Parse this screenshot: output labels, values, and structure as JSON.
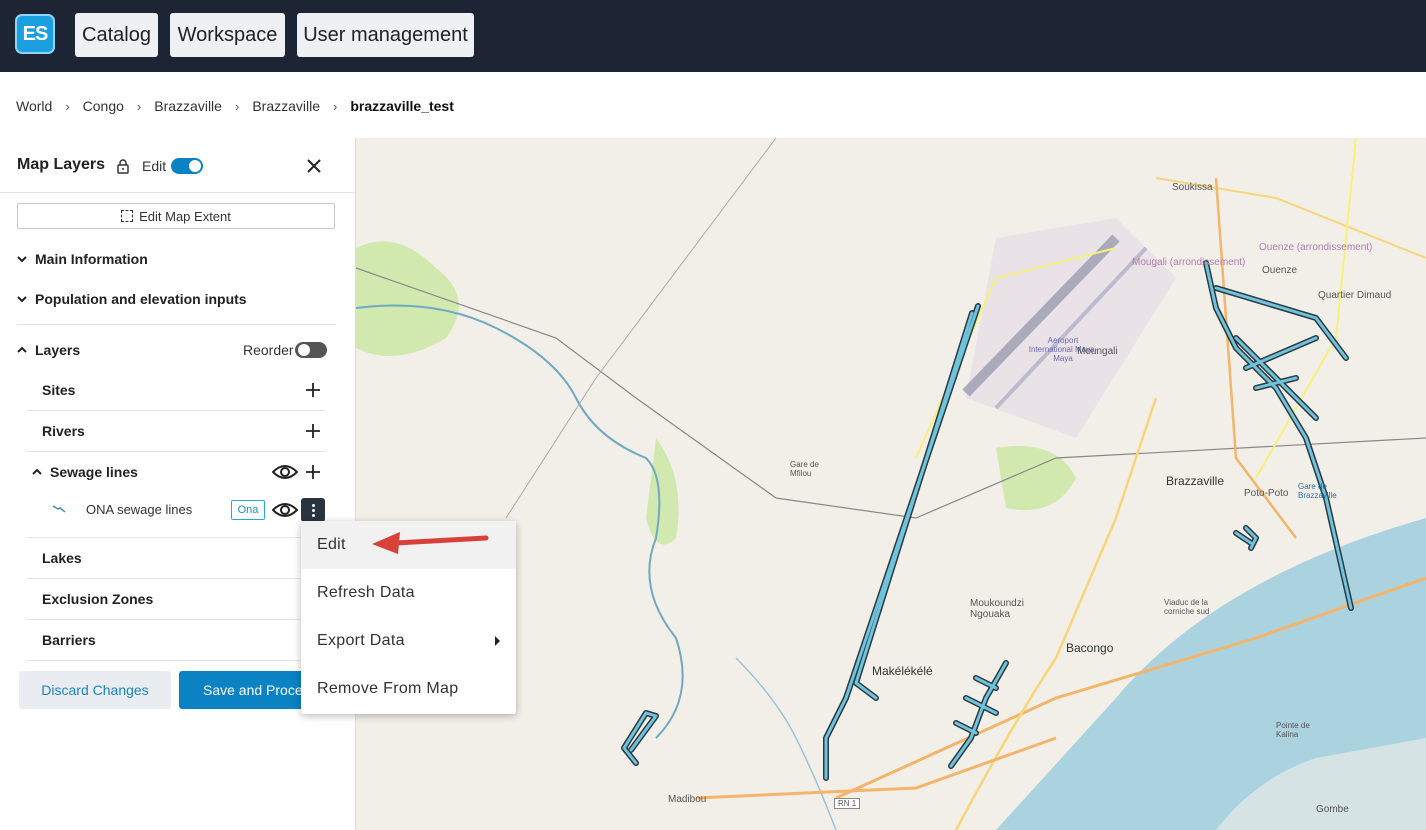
{
  "app": {
    "logo_text": "ES",
    "nav": [
      "Catalog",
      "Workspace",
      "User management"
    ]
  },
  "breadcrumb": [
    "World",
    "Congo",
    "Brazzaville",
    "Brazzaville",
    "brazzaville_test"
  ],
  "sidebar": {
    "title": "Map Layers",
    "edit_label": "Edit",
    "edit_enabled": true,
    "extent_button": "Edit Map Extent",
    "sections": {
      "main_info": "Main Information",
      "population": "Population and elevation inputs",
      "layers": "Layers"
    },
    "reorder_label": "Reorder",
    "reorder_enabled": false,
    "layers": [
      {
        "label": "Sites"
      },
      {
        "label": "Rivers"
      },
      {
        "label": "Sewage lines"
      },
      {
        "label": "Lakes"
      },
      {
        "label": "Exclusion Zones"
      },
      {
        "label": "Barriers"
      }
    ],
    "sub_layer": {
      "label": "ONA sewage lines",
      "badge": "Ona"
    },
    "discard_button": "Discard Changes",
    "save_button": "Save and Process"
  },
  "context_menu": {
    "items": [
      "Edit",
      "Refresh Data",
      "Export Data",
      "Remove From Map"
    ]
  },
  "map": {
    "labels": [
      "Soukissa",
      "Ouenze (arrondissement)",
      "Ouenze",
      "Quartier Dimaud",
      "Mougali (arrondissement)",
      "Aeroport International Maya-Maya",
      "Moungali",
      "Brazzaville",
      "Poto-Poto",
      "Gare de Brazzaville",
      "Gare de Mfilou",
      "Moukoundzi Ngouaka",
      "Makélékélé",
      "Bacongo",
      "Viaduc de la corniche sud",
      "Pointe de Kalina",
      "Madibou",
      "Gombe",
      "RN 1"
    ],
    "colors": {
      "background": "#f2efe9",
      "water": "#aad3df",
      "park": "#c8e6a0",
      "sewage_line": "#6fc3dc",
      "sewage_outline": "#2b3a40"
    }
  }
}
